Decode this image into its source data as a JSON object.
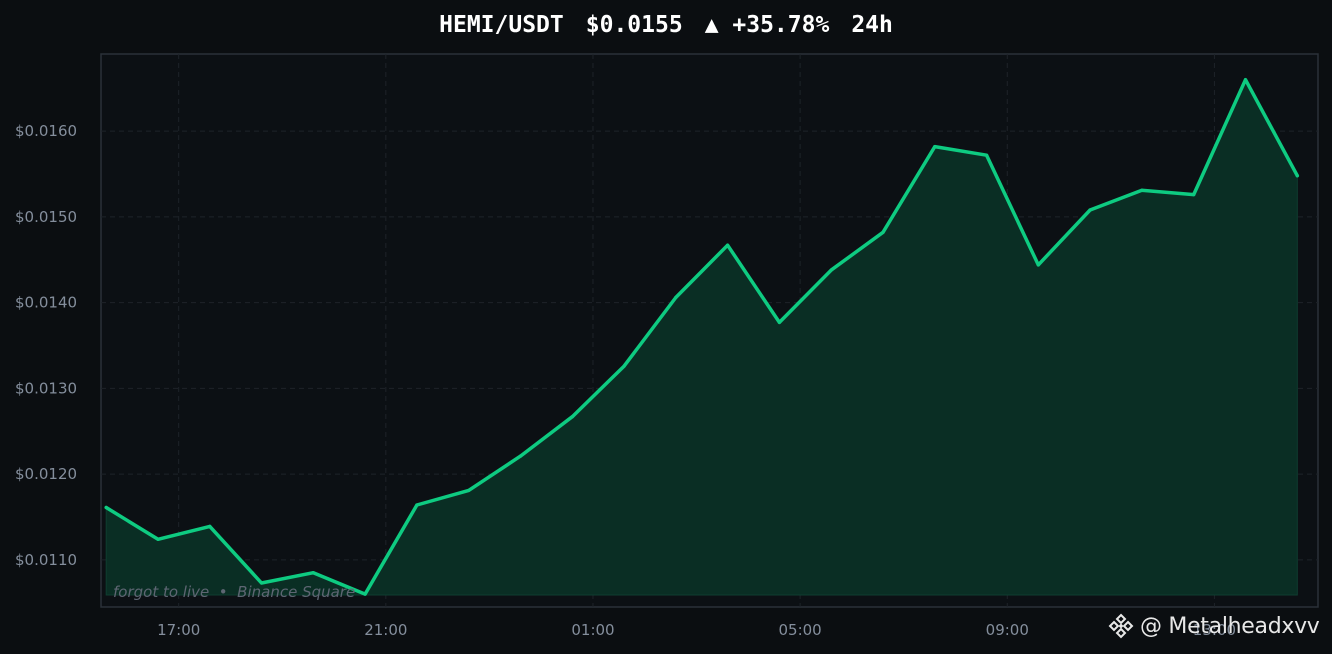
{
  "header": {
    "pair": "HEMI/USDT",
    "price": "$0.0155",
    "change": "▲ +35.78%",
    "period": "24h"
  },
  "colors": {
    "background": "#0b0e11",
    "plot_background": "#0c1014",
    "line": "#0ecb81",
    "fill": "#0a2e24",
    "grid": "#1e2329",
    "tick": "#848e9c",
    "caption": "#5e6673"
  },
  "caption": "forgot to live  •  Binance Square",
  "watermark": {
    "icon": "binance-logo-icon",
    "handle": "@ Metalheadxvv"
  },
  "chart_data": {
    "type": "area",
    "ylim": [
      0.01045,
      0.0169
    ],
    "xlim": [
      15.5,
      39.0
    ],
    "baseline": 0.01059,
    "grid": true,
    "x_ticks": [
      {
        "x": 17,
        "label": "17:00"
      },
      {
        "x": 21,
        "label": "21:00"
      },
      {
        "x": 25,
        "label": "01:00"
      },
      {
        "x": 29,
        "label": "05:00"
      },
      {
        "x": 33,
        "label": "09:00"
      },
      {
        "x": 37,
        "label": "13:00"
      }
    ],
    "y_ticks": [
      {
        "y": 0.011,
        "label": "$0.0110"
      },
      {
        "y": 0.012,
        "label": "$0.0120"
      },
      {
        "y": 0.013,
        "label": "$0.0130"
      },
      {
        "y": 0.014,
        "label": "$0.0140"
      },
      {
        "y": 0.015,
        "label": "$0.0150"
      },
      {
        "y": 0.016,
        "label": "$0.0160"
      }
    ],
    "x": [
      15.6,
      16.6,
      17.6,
      18.6,
      19.6,
      20.6,
      21.6,
      22.6,
      23.6,
      24.6,
      25.6,
      26.6,
      27.6,
      28.6,
      29.6,
      30.6,
      31.6,
      32.6,
      33.6,
      34.6,
      35.6,
      36.6,
      37.6,
      38.6
    ],
    "values": [
      0.01161,
      0.01124,
      0.01139,
      0.01073,
      0.01085,
      0.0106,
      0.01164,
      0.01181,
      0.01221,
      0.01267,
      0.01326,
      0.01406,
      0.01467,
      0.01377,
      0.01438,
      0.01482,
      0.01582,
      0.01572,
      0.01444,
      0.01508,
      0.01531,
      0.01526,
      0.0166,
      0.01548
    ]
  }
}
